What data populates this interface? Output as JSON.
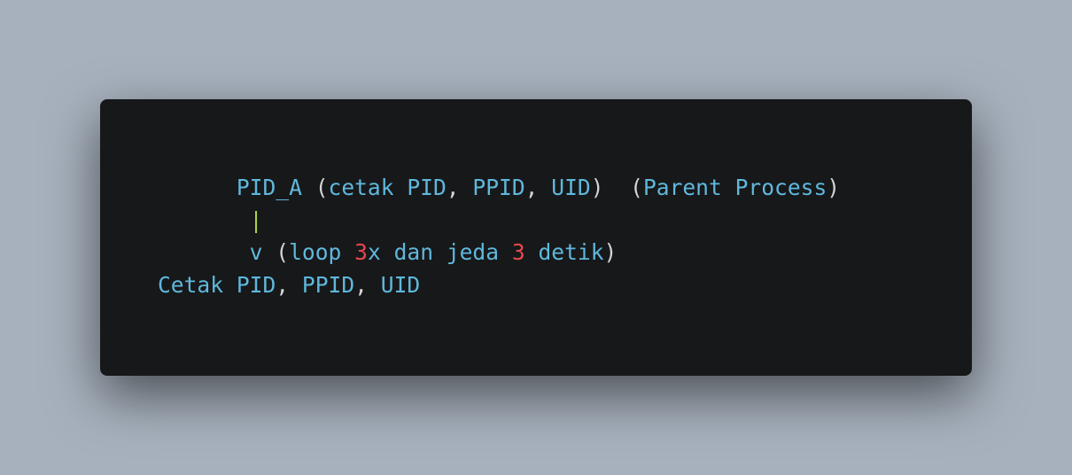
{
  "code": {
    "line1": {
      "ident1": "PID_A",
      "paren_open": "(",
      "ident2": "cetak",
      "ident3": "PID",
      "comma1": ",",
      "ident4": "PPID",
      "comma2": ",",
      "ident5": "UID",
      "paren_close": ")",
      "paren2_open": "(",
      "ident6": "Parent",
      "ident7": "Process",
      "paren2_close": ")"
    },
    "line2": {
      "pipe": "|"
    },
    "line3": {
      "arrow": "v",
      "paren_open": "(",
      "ident1": "loop",
      "num1": "3",
      "ident2": "x",
      "ident3": "dan",
      "ident4": "jeda",
      "num2": "3",
      "ident5": "detik",
      "paren_close": ")"
    },
    "line4": {
      "ident1": "Cetak",
      "ident2": "PID",
      "comma1": ",",
      "ident3": "PPID",
      "comma2": ",",
      "ident4": "UID"
    }
  },
  "colors": {
    "background": "#a7b1bd",
    "card": "#17181a",
    "identifier": "#5fb8dc",
    "punctuation": "#d4d4d4",
    "number": "#e5484d",
    "pipe": "#a9d24a"
  }
}
